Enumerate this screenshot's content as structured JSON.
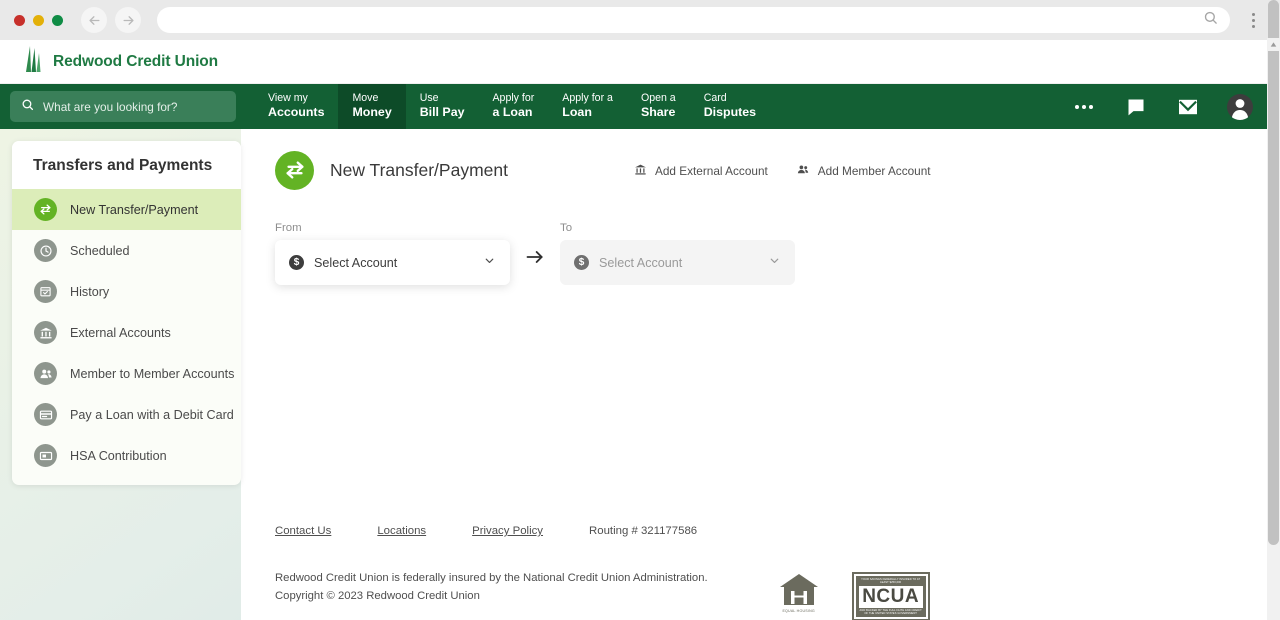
{
  "browser": {
    "url_value": "",
    "url_placeholder": "",
    "back_icon": "back-arrow-icon",
    "forward_icon": "forward-arrow-icon",
    "search_icon": "search-icon",
    "menu_icon": "kebab-menu-icon"
  },
  "header": {
    "brand_name": "Redwood Credit Union",
    "logo_icon": "redwood-tree-logo",
    "brand_color": "#1f7a43"
  },
  "nav": {
    "search_placeholder": "What are you looking for?",
    "search_value": "",
    "search_icon": "search-icon",
    "bar_color": "#136034",
    "active_color": "#0d4b28",
    "items": [
      {
        "line1": "View my",
        "line2": "Accounts",
        "active": false
      },
      {
        "line1": "Move",
        "line2": "Money",
        "active": true
      },
      {
        "line1": "Use",
        "line2": "Bill Pay",
        "active": false
      },
      {
        "line1": "Apply for",
        "line2": "a Loan",
        "active": false
      },
      {
        "line1": "Apply for a",
        "line2": "Loan",
        "active": false
      },
      {
        "line1": "Open a",
        "line2": "Share",
        "active": false
      },
      {
        "line1": "Card",
        "line2": "Disputes",
        "active": false
      }
    ],
    "more_icon": "more-horizontal-icon",
    "chat_icon": "chat-bubble-icon",
    "mail_icon": "envelope-icon",
    "profile_icon": "user-avatar-icon"
  },
  "sidebar": {
    "title": "Transfers and Payments",
    "items": [
      {
        "label": "New Transfer/Payment",
        "icon": "transfer-arrows-icon",
        "active": true
      },
      {
        "label": "Scheduled",
        "icon": "clock-icon",
        "active": false
      },
      {
        "label": "History",
        "icon": "calendar-check-icon",
        "active": false
      },
      {
        "label": "External Accounts",
        "icon": "bank-icon",
        "active": false
      },
      {
        "label": "Member to Member Accounts",
        "icon": "people-icon",
        "active": false
      },
      {
        "label": "Pay a Loan with a Debit Card",
        "icon": "credit-card-icon",
        "active": false
      },
      {
        "label": "HSA Contribution",
        "icon": "money-card-icon",
        "active": false
      }
    ],
    "active_bg": "#dcedb9",
    "active_icon_color": "#63b324"
  },
  "main": {
    "page_title": "New Transfer/Payment",
    "page_icon": "transfer-arrows-icon",
    "actions": [
      {
        "label": "Add External Account",
        "icon": "bank-icon"
      },
      {
        "label": "Add Member Account",
        "icon": "people-icon"
      }
    ],
    "from": {
      "label": "From",
      "value": "Select Account",
      "icon": "dollar-coin-icon",
      "chevron": "chevron-down-icon",
      "disabled": false
    },
    "to": {
      "label": "To",
      "value": "Select Account",
      "icon": "dollar-coin-icon",
      "chevron": "chevron-down-icon",
      "disabled": true
    },
    "direction_icon": "arrow-right-icon"
  },
  "footer": {
    "links": [
      {
        "label": "Contact Us"
      },
      {
        "label": "Locations"
      },
      {
        "label": "Privacy Policy"
      }
    ],
    "routing": "Routing # 321177586",
    "legal_line1": "Redwood Credit Union is federally insured by the National Credit Union Administration.",
    "legal_line2": "Copyright © 2023 Redwood Credit Union",
    "eho_icon": "equal-housing-opportunity-icon",
    "eho_label": "EQUAL HOUSING",
    "ncua_top": "YOUR SAVINGS FEDERALLY INSURED TO AT LEAST $250,000",
    "ncua_word": "NCUA",
    "ncua_bottom": "AND BACKED BY THE FULL FAITH AND CREDIT OF THE UNITED STATES GOVERNMENT"
  }
}
